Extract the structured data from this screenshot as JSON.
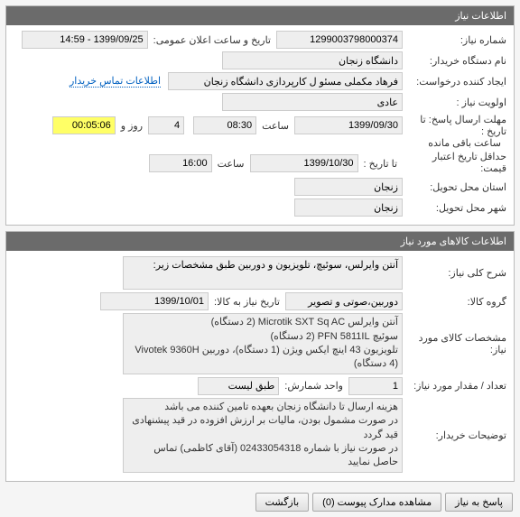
{
  "panel1": {
    "title": "اطلاعات نیاز",
    "need_number_label": "شماره نیاز:",
    "need_number": "1299003798000374",
    "announce_label": "تاریخ و ساعت اعلان عمومی:",
    "announce_value": "1399/09/25 - 14:59",
    "buyer_org_label": "نام دستگاه خریدار:",
    "buyer_org": "دانشگاه زنجان",
    "requester_label": "ایجاد کننده درخواست:",
    "requester": "فرهاد مکملی مسئو ل کارپردازی دانشگاه زنجان",
    "contact_link": "اطلاعات تماس خریدار",
    "priority_label": "اولویت نیاز :",
    "priority": "عادی",
    "deadline_label": "مهلت ارسال پاسخ:  تا تاریخ :",
    "deadline_date": "1399/09/30",
    "time_label": "ساعت",
    "deadline_time": "08:30",
    "days": "4",
    "days_label": "روز و",
    "countdown": "00:05:06",
    "remaining_label": "ساعت باقی مانده",
    "min_credit_label": "حداقل تاریخ اعتبار قیمت:",
    "credit_until_label": "تا تاریخ :",
    "credit_date": "1399/10/30",
    "credit_time": "16:00",
    "province_label": "استان محل تحویل:",
    "province": "زنجان",
    "city_label": "شهر محل تحویل:",
    "city": "زنجان"
  },
  "panel2": {
    "title": "اطلاعات کالاهای مورد نیاز",
    "desc_label": "شرح کلی نیاز:",
    "desc": "آنتن وایرلس، سوئیچ، تلویزیون و دوربین طبق مشخصات زیر:",
    "group_label": "گروه کالا:",
    "group": "دوربین،صوتی و تصویر",
    "need_date_label": "تاریخ نیاز به کالا:",
    "need_date": "1399/10/01",
    "spec_label": "مشخصات کالای مورد نیاز:",
    "spec": "آنتن وایرلس Microtik SXT Sq AC (2 دستگاه)\nسوئیچ PFN 5811IL (2 دستگاه)\nتلویزیون 43 اینچ ایکس ویژن (1 دستگاه)، دوربین Vivotek 9360H (4 دستگاه)",
    "qty_label": "تعداد / مقدار مورد نیاز:",
    "qty": "1",
    "unit_label": "واحد شمارش:",
    "unit": "طبق لیست",
    "notes_label": "توضیحات خریدار:",
    "notes": "هزینه ارسال تا دانشگاه زنجان بعهده تامین کننده می باشد\nدر صورت مشمول بودن، مالیات بر ارزش افزوده در قید پیشنهادی قید گردد\nدر صورت نیاز با شماره 02433054318 (آقای کاظمی) تماس حاصل نمایید"
  },
  "actions": {
    "respond": "پاسخ به نیاز",
    "view_docs": "مشاهده مدارک پیوست (0)",
    "back": "بازگشت"
  }
}
